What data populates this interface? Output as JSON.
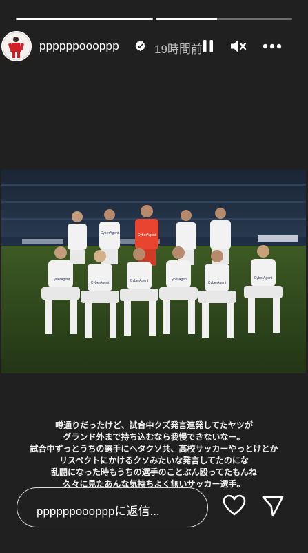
{
  "story": {
    "progress_segments": [
      1.0,
      0.45
    ],
    "username": "ppppppoooppp",
    "verified": true,
    "timestamp": "19時間前",
    "icons": {
      "pause": "pause-icon",
      "mute": "speaker-muted-icon",
      "more": "more-options-icon",
      "verified": "verified-badge-icon",
      "like": "heart-icon",
      "send": "send-icon"
    },
    "photo": {
      "jersey_sponsor": "CyberAgent"
    },
    "caption_lines": [
      "噂通りだったけど、試合中クズ発言連発してたヤツが",
      "グランド外まで持ち込むなら我慢できないなー。",
      "試合中ずっとうちの選手にヘタクソ共、高校サッカーやっとけとか",
      "リスペクトにかけるクソみたいな発言してたのにな",
      "乱闘になった時もうちの選手のことぶん殴ってたもんね",
      "久々に見たあんな気持ちよく無いサッカー選手。"
    ]
  },
  "reply": {
    "placeholder": "ppppppooopppに返信..."
  },
  "colors": {
    "background": "#202020",
    "keeper_kit": "#e8442f",
    "outfield_kit": "#f2f2f2",
    "pitch": "#2f4a1c"
  }
}
